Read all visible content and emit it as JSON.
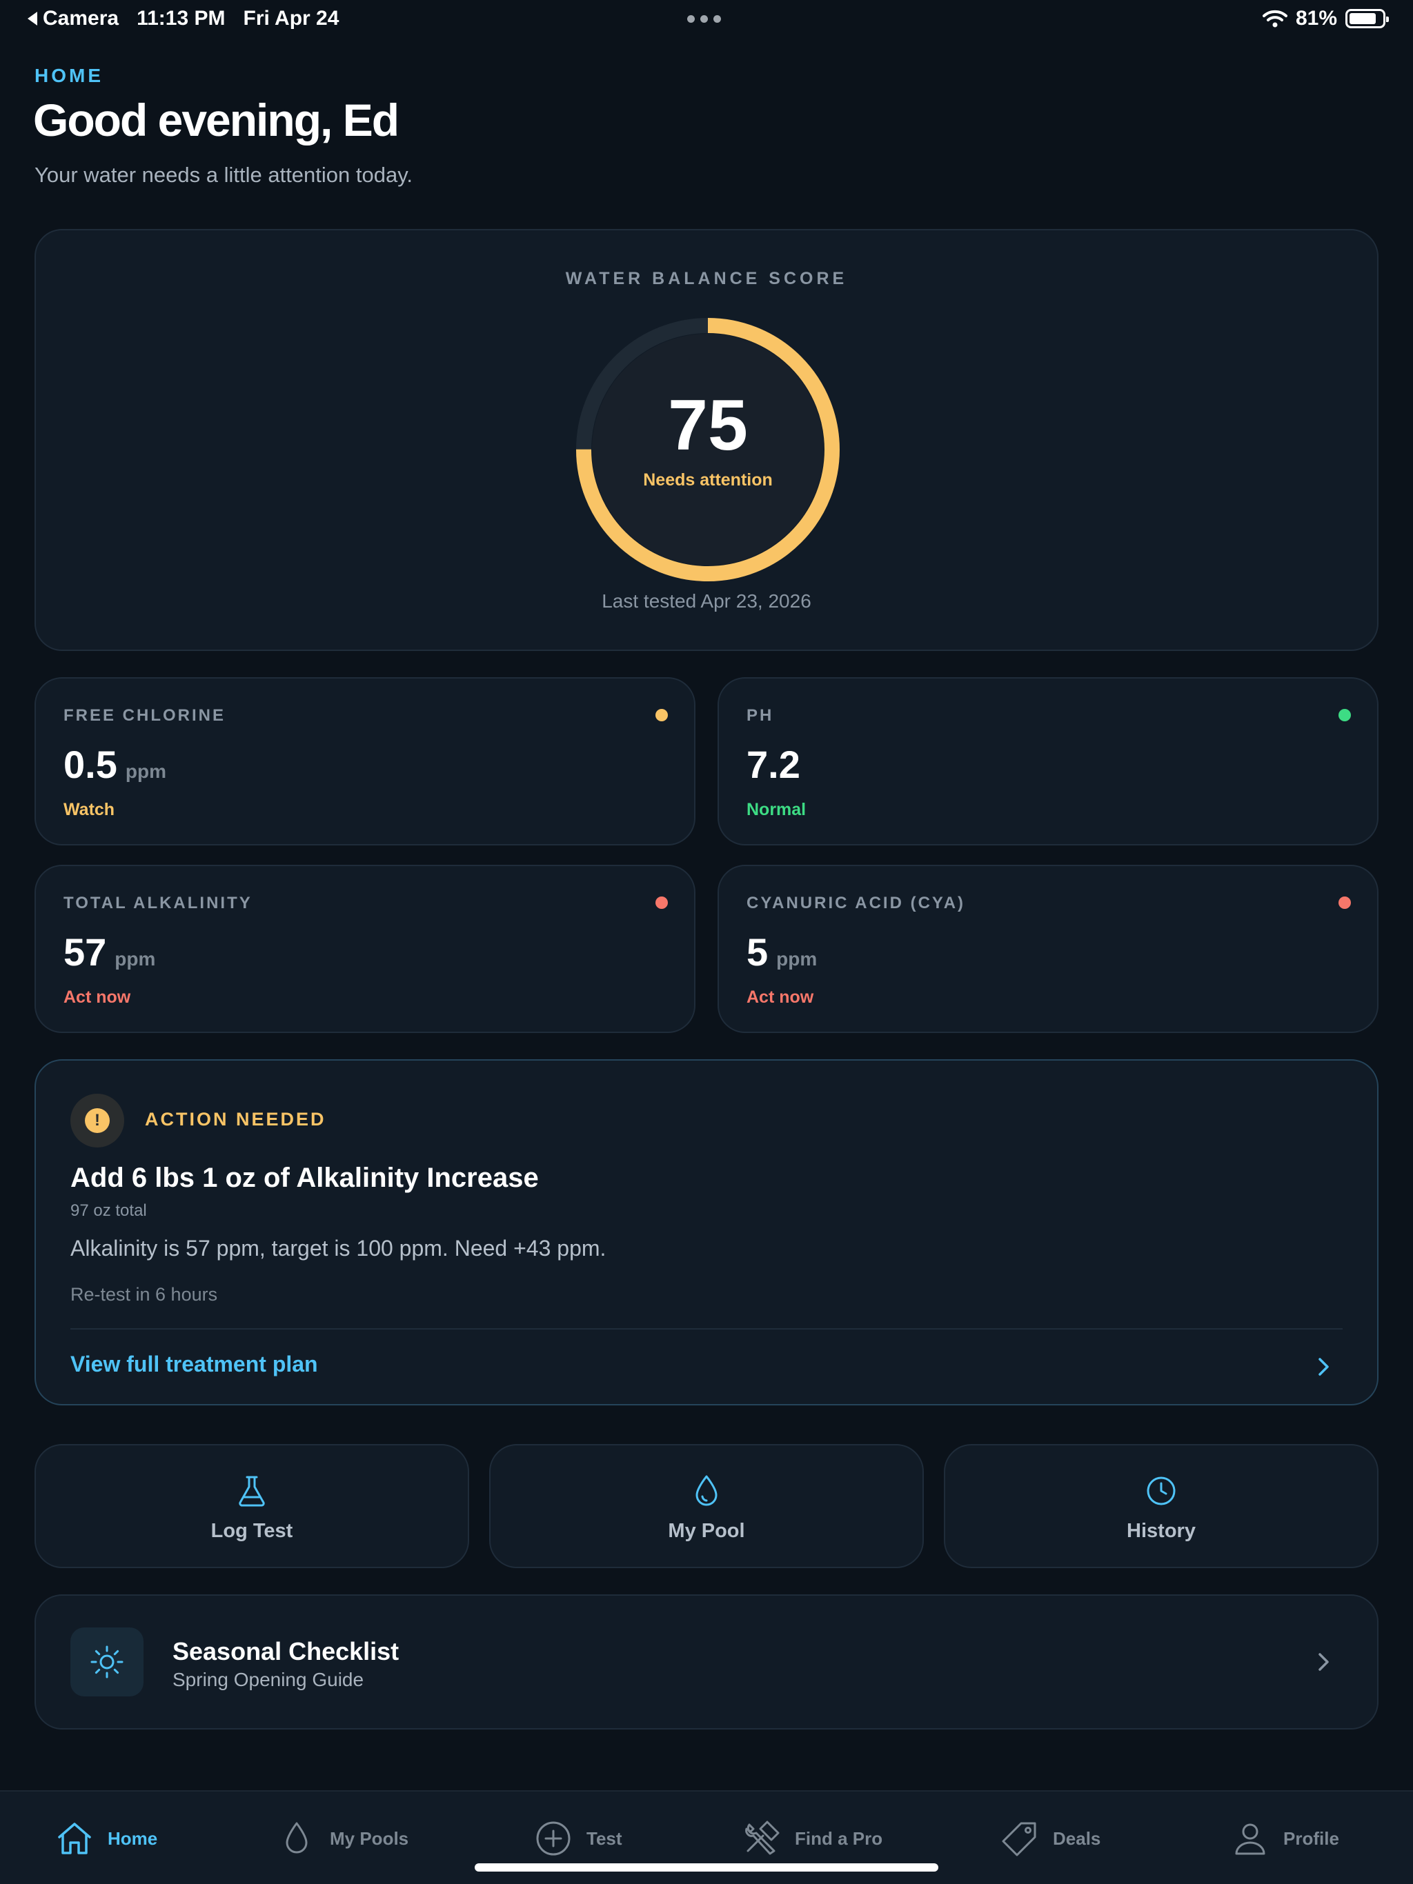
{
  "status_bar": {
    "back_app": "Camera",
    "time": "11:13 PM",
    "date": "Fri Apr 24",
    "battery": "81%"
  },
  "header": {
    "eyebrow": "HOME",
    "greeting": "Good evening, Ed",
    "subtitle": "Your water needs a little attention today."
  },
  "score": {
    "label": "WATER BALANCE SCORE",
    "value": 75,
    "max": 100,
    "status": "Needs attention",
    "last_tested": "Last tested Apr 23, 2026",
    "ring_color": "#f9c466",
    "track_color": "#1f2a35"
  },
  "metrics": [
    {
      "label": "FREE CHLORINE",
      "value": "0.5",
      "unit": "ppm",
      "status": "Watch",
      "color": "#f9c466"
    },
    {
      "label": "PH",
      "value": "7.2",
      "unit": "",
      "status": "Normal",
      "color": "#3ddc84"
    },
    {
      "label": "TOTAL ALKALINITY",
      "value": "57",
      "unit": "ppm",
      "status": "Act now",
      "color": "#f7776a"
    },
    {
      "label": "CYANURIC ACID (CYA)",
      "value": "5",
      "unit": "ppm",
      "status": "Act now",
      "color": "#f7776a"
    }
  ],
  "action": {
    "label": "ACTION NEEDED",
    "icon": "exclamation-icon",
    "title": "Add 6 lbs 1 oz of Alkalinity Increase",
    "subtitle": "97 oz total",
    "description": "Alkalinity is 57 ppm, target is 100 ppm. Need +43 ppm.",
    "retest": "Re-test in 6 hours",
    "link": "View full treatment plan"
  },
  "quick_actions": [
    {
      "label": "Log Test",
      "icon": "flask-icon"
    },
    {
      "label": "My Pool",
      "icon": "droplet-icon"
    },
    {
      "label": "History",
      "icon": "clock-icon"
    }
  ],
  "seasonal": {
    "title": "Seasonal Checklist",
    "subtitle": "Spring Opening Guide",
    "icon": "sun-icon"
  },
  "tabs": [
    {
      "label": "Home",
      "icon": "home-icon",
      "active": true
    },
    {
      "label": "My Pools",
      "icon": "droplet-icon",
      "active": false
    },
    {
      "label": "Test",
      "icon": "plus-circle-icon",
      "active": false
    },
    {
      "label": "Find a Pro",
      "icon": "tools-icon",
      "active": false
    },
    {
      "label": "Deals",
      "icon": "tag-icon",
      "active": false
    },
    {
      "label": "Profile",
      "icon": "person-icon",
      "active": false
    }
  ],
  "colors": {
    "accent": "#4fc3f7",
    "background": "#0b121a",
    "card": "#111b26",
    "warning": "#f9c466",
    "good": "#3ddc84",
    "bad": "#f7776a"
  }
}
